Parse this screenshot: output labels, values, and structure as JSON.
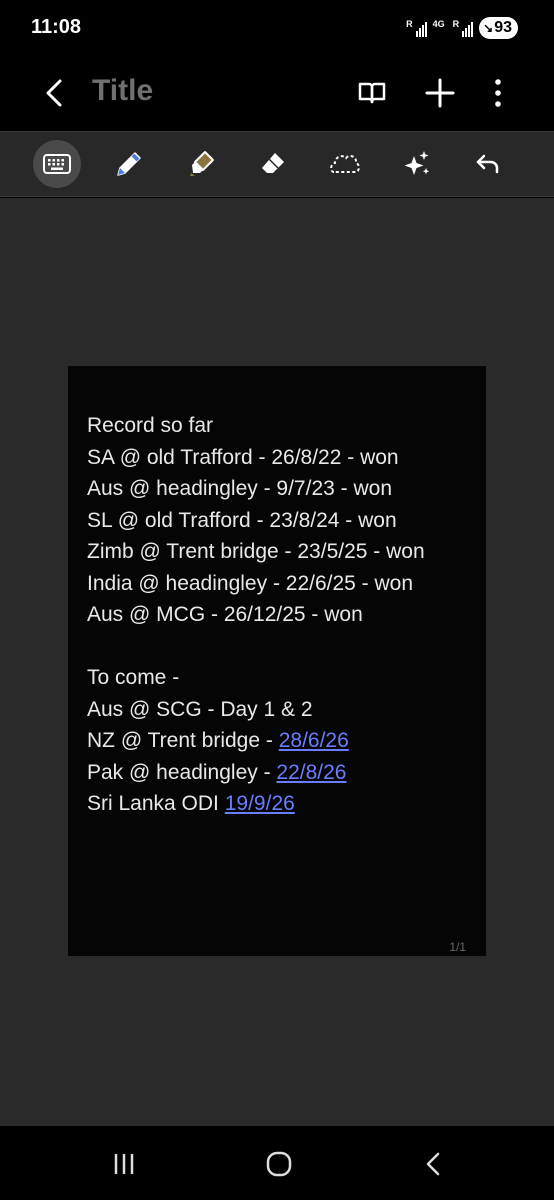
{
  "status": {
    "time": "11:08",
    "signal1_label": "R",
    "signal2_label": "4G",
    "signal3_label": "R",
    "battery": "93"
  },
  "app_bar": {
    "title": "Title"
  },
  "toolbar": {
    "tools": [
      "keyboard-icon",
      "pen-icon",
      "highlighter-icon",
      "eraser-icon",
      "lasso-icon",
      "ai-sparkle-icon",
      "undo-icon"
    ],
    "active_tool": "keyboard-icon"
  },
  "note": {
    "lines": [
      "Record so far",
      "SA @ old Trafford - 26/8/22 - won",
      "Aus @ headingley - 9/7/23 - won",
      "SL @ old Trafford - 23/8/24 - won",
      "Zimb @ Trent bridge - 23/5/25 - won",
      "India @ headingley - 22/6/25 - won",
      "Aus @ MCG - 26/12/25 - won",
      "",
      "To come -",
      "Aus @ SCG - Day 1 & 2"
    ],
    "link_lines": [
      {
        "prefix": "NZ @ Trent bridge - ",
        "link": "28/6/26"
      },
      {
        "prefix": "Pak @ headingley - ",
        "link": "22/8/26"
      },
      {
        "prefix": "Sri Lanka ODI ",
        "link": "19/9/26"
      }
    ],
    "page_indicator": "1/1"
  },
  "colors": {
    "link": "#6a7dff",
    "toolbar_bg": "#282828",
    "canvas_bg": "#2a2a2a",
    "page_bg": "#050505"
  }
}
